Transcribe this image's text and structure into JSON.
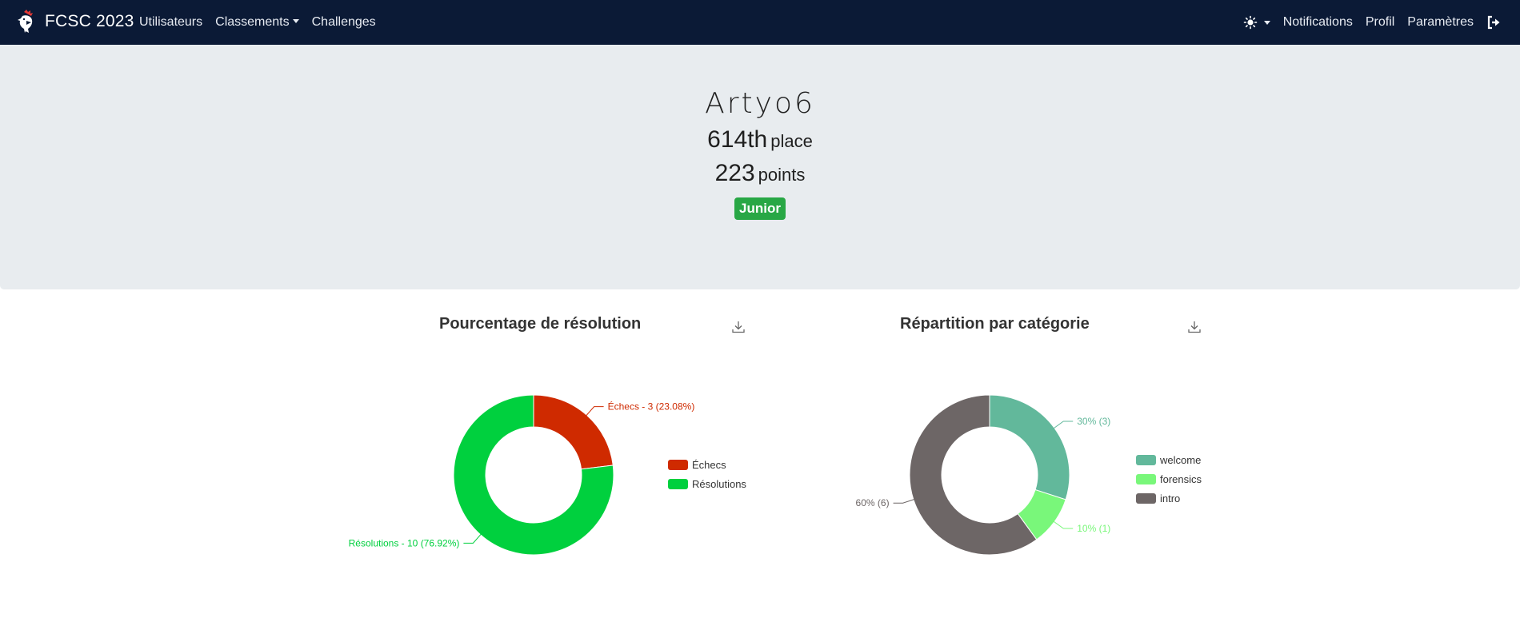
{
  "navbar": {
    "brand": "FCSC 2023",
    "links": [
      "Utilisateurs",
      "Classements",
      "Challenges"
    ],
    "right_links": [
      "Notifications",
      "Profil",
      "Paramètres"
    ],
    "theme_icon": "sun-icon",
    "logout_icon": "logout-icon",
    "background": "#0b1a36"
  },
  "profile": {
    "username": "Artyo6",
    "place_number": "614th",
    "place_word": "place",
    "points_number": "223",
    "points_word": "points",
    "badge": "Junior",
    "badge_color": "#28a745"
  },
  "chart_data": [
    {
      "type": "pie",
      "title": "Pourcentage de résolution",
      "labels": [
        "Échecs",
        "Résolutions"
      ],
      "values": [
        3,
        10
      ],
      "percents": [
        23.08,
        76.92
      ],
      "colors": [
        "#cf2a00",
        "#00d03e"
      ],
      "slice_labels": [
        "Échecs - 3 (23.08%)",
        "Résolutions - 10 (76.92%)"
      ],
      "legend": "right"
    },
    {
      "type": "pie",
      "title": "Répartition par catégorie",
      "labels": [
        "welcome",
        "forensics",
        "intro"
      ],
      "values": [
        3,
        1,
        6
      ],
      "percents": [
        30,
        10,
        60
      ],
      "colors": [
        "#62b89b",
        "#79f77a",
        "#6d6666"
      ],
      "slice_labels": [
        "30% (3)",
        "10% (1)",
        "60% (6)"
      ],
      "legend": "right"
    }
  ]
}
